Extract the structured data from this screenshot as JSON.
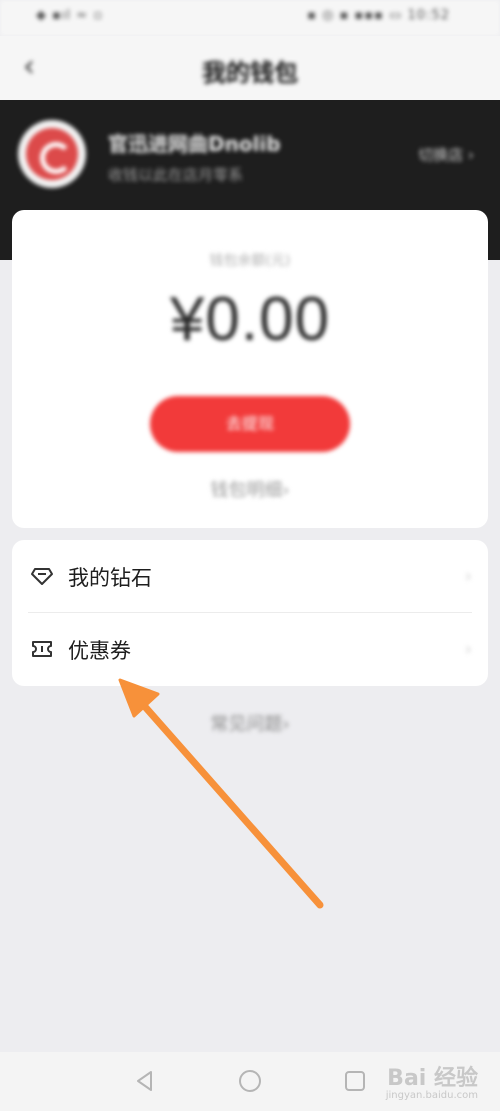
{
  "status_bar": {
    "left": "◆ ▪ıl ≈ ▫",
    "right": "▪ ◎ ▪ ▪▪▪ ▭ 10:52"
  },
  "nav": {
    "title": "我的钱包"
  },
  "account": {
    "shop_name": "官迅进网曲Dnolib",
    "shop_subtitle": "收钱以此在店月零系",
    "switch_label": "切换店 ›"
  },
  "wallet": {
    "balance_label": "钱包余额(元)",
    "balance": "¥0.00",
    "withdraw_label": "去提现",
    "detail_label": "钱包明细›"
  },
  "menu": {
    "items": [
      {
        "label": "我的钻石",
        "icon": "diamond-icon"
      },
      {
        "label": "优惠券",
        "icon": "ticket-icon"
      }
    ]
  },
  "faq": {
    "label": "常见问题›"
  },
  "watermark": {
    "main": "Bai 经验",
    "sub": "jingyan.baidu.com"
  },
  "colors": {
    "accent": "#f23a3a",
    "annotation_arrow": "#f7913a",
    "header_bg": "#1e1e1e"
  }
}
